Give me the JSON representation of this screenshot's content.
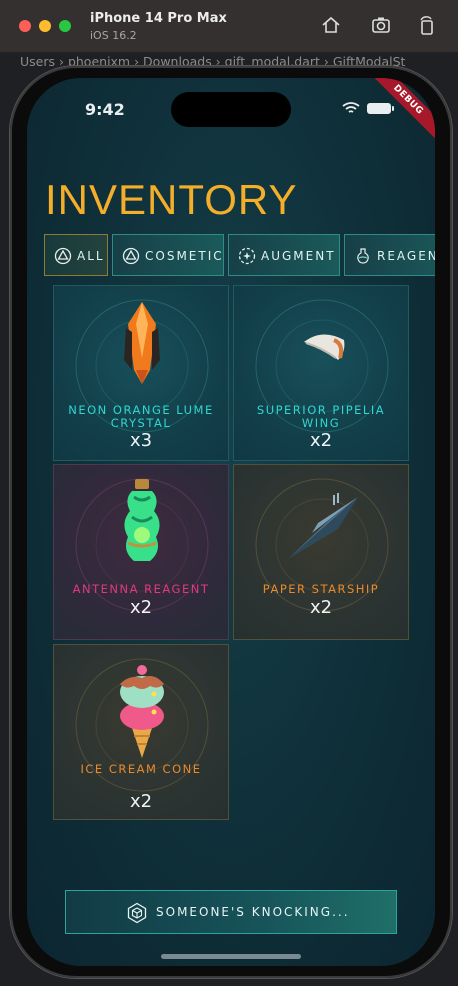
{
  "window": {
    "device_name": "iPhone 14 Pro Max",
    "os_version": "iOS 16.2"
  },
  "editor": {
    "breadcrumb": "Users › phoenixm › Downloads › gift_modal.dart › GiftModalSt"
  },
  "status_bar": {
    "time": "9:42",
    "debug_label": "DEBUG"
  },
  "page": {
    "title": "INVENTORY"
  },
  "tabs": [
    {
      "label": "ALL",
      "active": true,
      "icon": "triangle-hex-icon"
    },
    {
      "label": "COSMETIC",
      "active": false,
      "icon": "triangle-hex-icon"
    },
    {
      "label": "AUGMENT",
      "active": false,
      "icon": "sparkle-gear-icon"
    },
    {
      "label": "REAGENT",
      "active": false,
      "icon": "potion-icon"
    }
  ],
  "items": [
    {
      "name": "NEON ORANGE LUME CRYSTAL",
      "qty": "x3",
      "theme": "teal",
      "name_color": "#2fd7cf"
    },
    {
      "name": "SUPERIOR PIPELIA WING",
      "qty": "x2",
      "theme": "teal",
      "name_color": "#2fd7cf"
    },
    {
      "name": "ANTENNA REAGENT",
      "qty": "x2",
      "theme": "pink",
      "name_color": "#e03a7f"
    },
    {
      "name": "PAPER STARSHIP",
      "qty": "x2",
      "theme": "gold",
      "name_color": "#e98a2a"
    },
    {
      "name": "ICE CREAM CONE",
      "qty": "x2",
      "theme": "gold",
      "name_color": "#e98a2a"
    }
  ],
  "action_button": {
    "label": "SOMEONE'S KNOCKING...",
    "icon": "hex-cube-icon"
  },
  "colors": {
    "title": "#f4ae2a",
    "accent_teal": "#2aa59b",
    "background": "#0f2f39"
  }
}
